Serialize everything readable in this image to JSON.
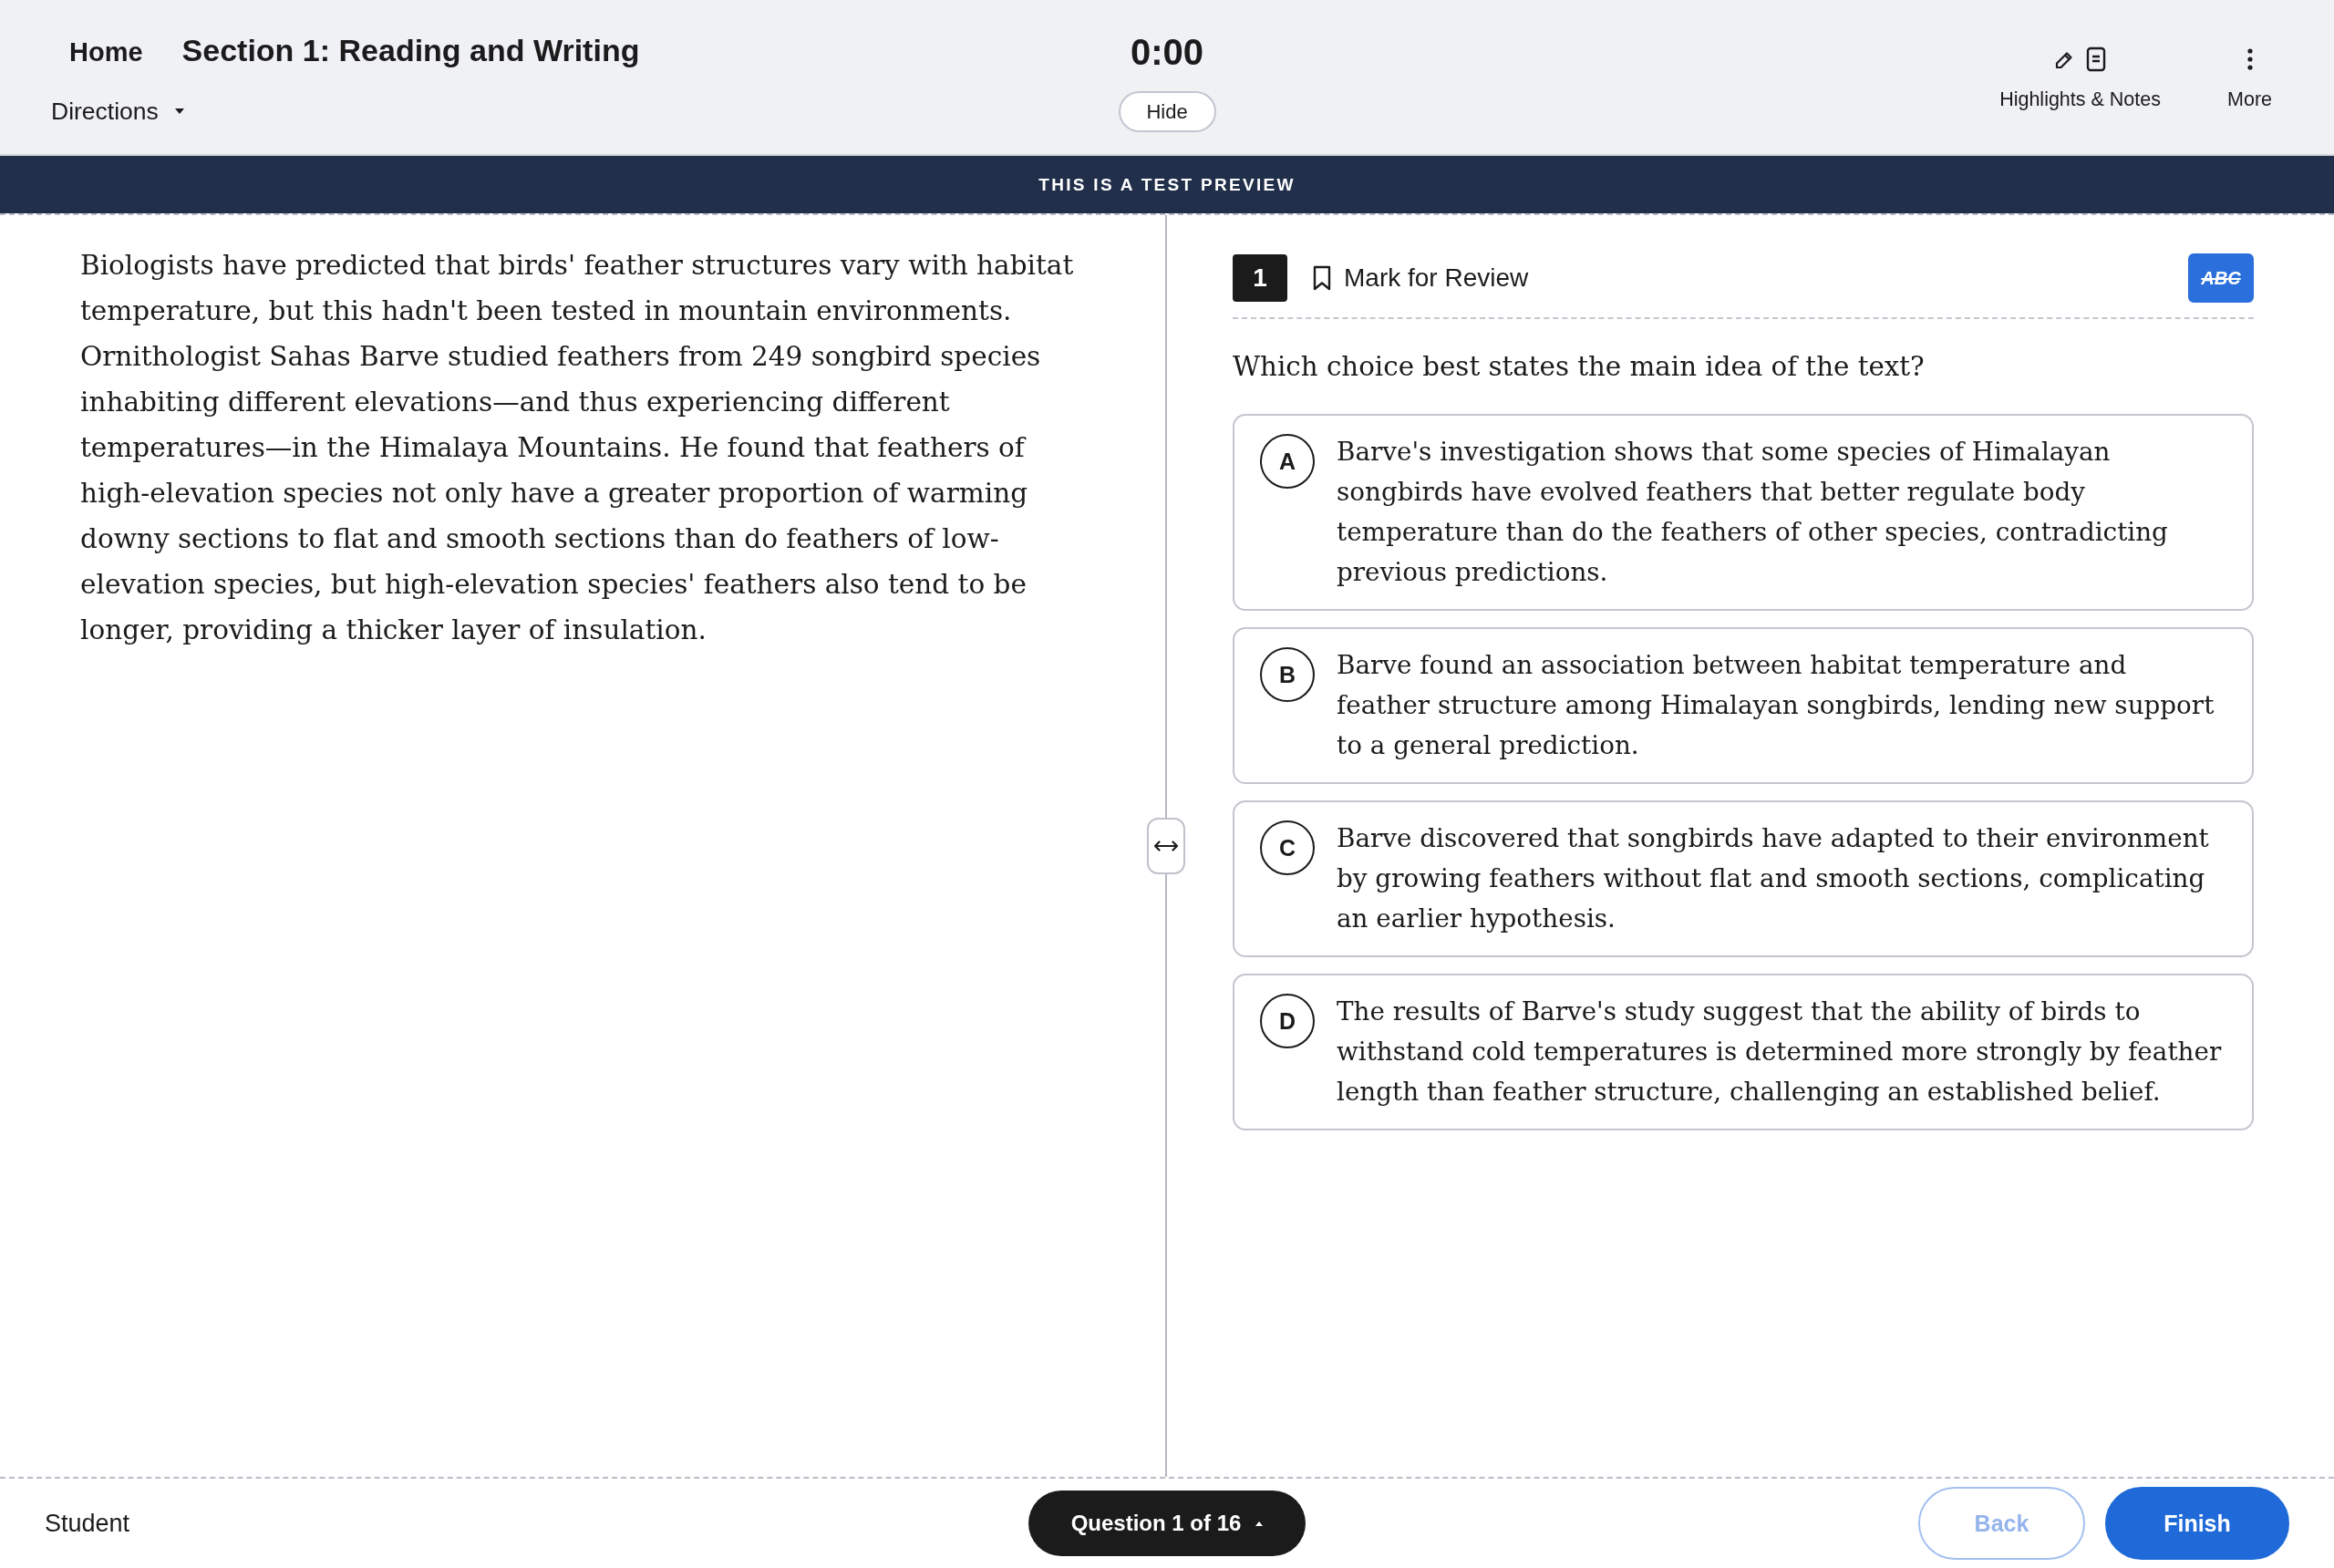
{
  "header": {
    "home": "Home",
    "section_title": "Section 1: Reading and Writing",
    "directions": {
      "label": "Directions",
      "expanded": false
    },
    "timer": {
      "time": "0:00",
      "hide_button": "Hide"
    },
    "tools": [
      {
        "kind": "highlights_notes",
        "label": "Highlights & Notes"
      },
      {
        "kind": "more",
        "label": "More"
      }
    ]
  },
  "banner": "THIS IS A TEST PREVIEW",
  "passage": "Biologists have predicted that birds' feather structures vary with habitat temperature, but this hadn't been tested in mountain environments. Ornithologist Sahas Barve studied feathers from 249 songbird species inhabiting different elevations—and thus experiencing different temperatures—in the Himalaya Mountains. He found that feathers of high-elevation species not only have a greater proportion of warming downy sections to flat and smooth sections than do feathers of low-elevation species, but high-elevation species' feathers also tend to be longer, providing a thicker layer of insulation.",
  "question": {
    "number": "1",
    "mark_for_review": {
      "label": "Mark for Review",
      "marked": false
    },
    "cross_out": {
      "label": "ABC",
      "active": true
    },
    "prompt": "Which choice best states the main idea of the text?",
    "choices": [
      {
        "letter": "A",
        "text": "Barve's investigation shows that some species of Himalayan songbirds have evolved feathers that better regulate body temperature than do the feathers of other species, contradicting previous predictions.",
        "selected": false
      },
      {
        "letter": "B",
        "text": "Barve found an association between habitat temperature and feather structure among Himalayan songbirds, lending new support to a general prediction.",
        "selected": false
      },
      {
        "letter": "C",
        "text": "Barve discovered that songbirds have adapted to their environment by growing feathers without flat and smooth sections, complicating an earlier hypothesis.",
        "selected": false
      },
      {
        "letter": "D",
        "text": "The results of Barve's study suggest that the ability of birds to withstand cold temperatures is determined more strongly by feather length than feather structure, challenging an established belief.",
        "selected": false
      }
    ]
  },
  "footer": {
    "student": "Student",
    "question_nav": {
      "label": "Question 1 of 16",
      "expanded": false
    },
    "back": {
      "label": "Back",
      "disabled": true
    },
    "finish": {
      "label": "Finish",
      "disabled": false
    }
  }
}
